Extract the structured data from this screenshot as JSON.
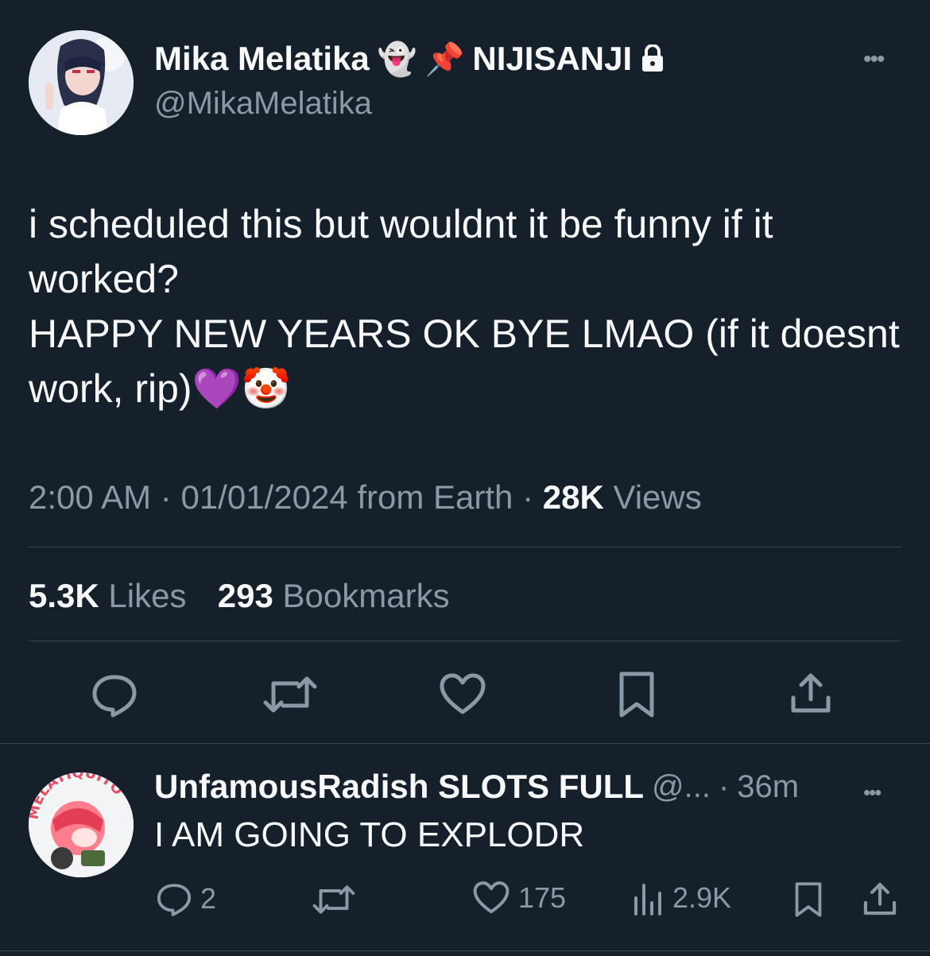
{
  "tweet": {
    "author_name": "Mika Melatika",
    "author_suffix": "NIJISANJI",
    "author_handle": "@MikaMelatika",
    "emoji_ghost": "👻",
    "emoji_pin": "📌",
    "text_line1": "i scheduled this but wouldnt it be funny if it",
    "text_line2": "worked?",
    "text_line3": "HAPPY NEW YEARS OK BYE LMAO (if it doesnt",
    "text_line4": "work, rip)",
    "emoji_heart": "💜",
    "emoji_clown": "🤡",
    "time": "2:00 AM",
    "date": "01/01/2024 from Earth",
    "views_count": "28K",
    "views_label": "Views",
    "likes_count": "5.3K",
    "likes_label": "Likes",
    "bookmarks_count": "293",
    "bookmarks_label": "Bookmarks",
    "dot": "·",
    "more": "•••"
  },
  "reply": {
    "author_name": "UnfamousRadish SLOTS FULL",
    "handle_truncated": "@...",
    "time": "36m",
    "text": "I AM GOING TO EXPLODR",
    "replies": "2",
    "likes": "175",
    "views": "2.9K",
    "avatar_text": "MELATIQUITO",
    "dot": "·",
    "more": "•••"
  },
  "colors": {
    "background": "#15202b",
    "text": "#f7f9f9",
    "muted": "#8b98a5",
    "separator": "#38444d"
  },
  "icons": [
    "lock-icon",
    "more-icon",
    "reply-icon",
    "retweet-icon",
    "like-icon",
    "bookmark-icon",
    "share-icon",
    "views-icon"
  ]
}
